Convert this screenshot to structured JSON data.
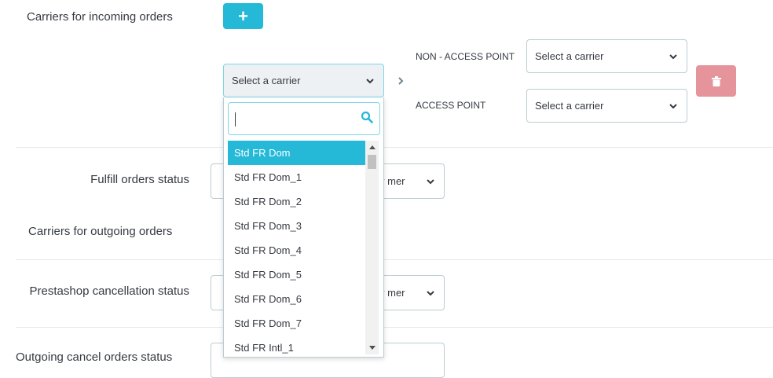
{
  "section_incoming": {
    "label": "Carriers for incoming orders",
    "add_button": "+",
    "carrier_select": {
      "value": "Select a carrier"
    },
    "non_access_point": {
      "label": "NON - ACCESS POINT",
      "value": "Select a carrier"
    },
    "access_point": {
      "label": "ACCESS POINT",
      "value": "Select a carrier"
    }
  },
  "dropdown": {
    "search_value": "",
    "options": [
      "Std FR Dom",
      "Std FR Dom_1",
      "Std FR Dom_2",
      "Std FR Dom_3",
      "Std FR Dom_4",
      "Std FR Dom_5",
      "Std FR Dom_6",
      "Std FR Dom_7",
      "Std FR Intl_1"
    ],
    "selected": "Std FR Dom"
  },
  "fulfill": {
    "label": "Fulfill orders status",
    "select_visible": "y mer"
  },
  "outgoing": {
    "label": "Carriers for outgoing orders"
  },
  "prestashop_cancel": {
    "label": "Prestashop cancellation status",
    "select_visible": "y mer"
  },
  "outgoing_cancel": {
    "label": "Outgoing cancel orders status"
  },
  "colors": {
    "accent": "#25b9d7",
    "danger": "#e6949b",
    "border": "#bbcdd2"
  }
}
